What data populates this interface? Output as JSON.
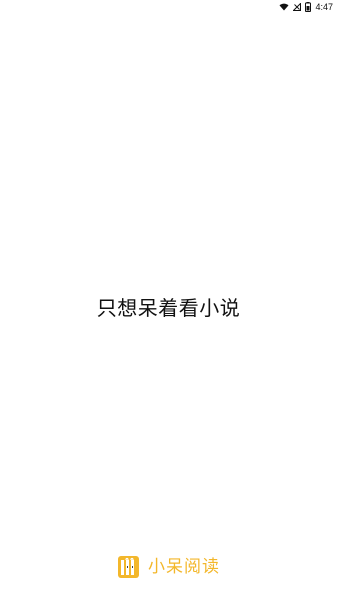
{
  "status_bar": {
    "time": "4:47",
    "icons": [
      "wifi-icon",
      "signal-icon",
      "battery-icon"
    ]
  },
  "splash": {
    "tagline": "只想呆着看小说"
  },
  "brand": {
    "name": "小呆阅读",
    "logo_icon": "book-logo-icon",
    "color": "#f3b72b"
  }
}
